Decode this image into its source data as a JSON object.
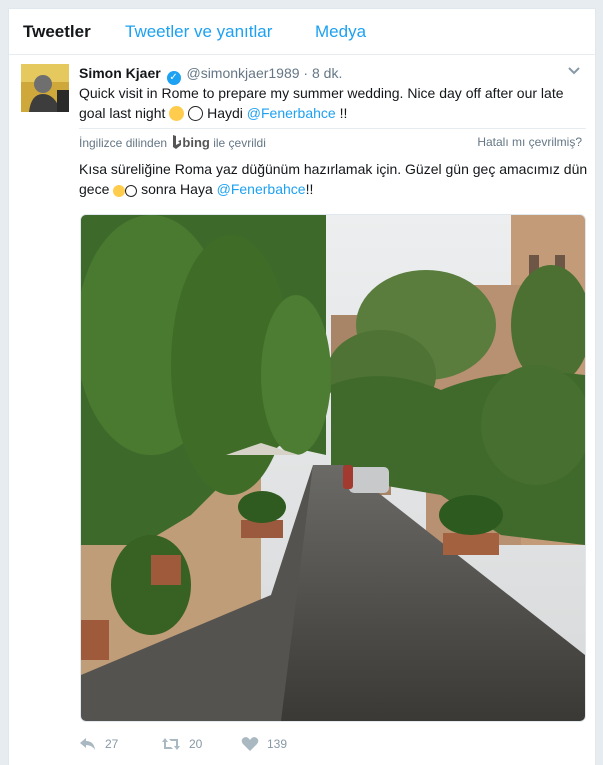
{
  "tabs": [
    {
      "label": "Tweetler"
    },
    {
      "label": "Tweetler ve yanıtlar"
    },
    {
      "label": "Medya"
    }
  ],
  "tweet": {
    "name": "Simon Kjaer",
    "handle": "@simonkjaer1989",
    "separator": "·",
    "time": "8 dk.",
    "text_part1": "Quick visit in Rome to prepare my summer wedding. Nice day off after our late goal last night",
    "text_part2": "Haydi",
    "mention": "@Fenerbahce",
    "text_end": "!!",
    "translation": {
      "prefix": "İngilizce dilinden",
      "brand": "bing",
      "suffix": "ile çevrildi",
      "report": "Hatalı mı çevrilmiş?"
    },
    "translated_part1": "Kısa süreliğine Roma yaz düğünüm hazırlamak için. Güzel gün geç amacımız dün gece",
    "translated_part2": "sonra  Haya",
    "translated_mention": "@Fenerbahce",
    "translated_end": "!!",
    "emoji_icons": [
      "grinning-face",
      "soccer-ball"
    ],
    "stats": {
      "replies": "27",
      "retweets": "20",
      "likes": "139"
    }
  },
  "colors": {
    "accent": "#1da1f2",
    "muted": "#657786",
    "background": "#e6ecf0"
  }
}
